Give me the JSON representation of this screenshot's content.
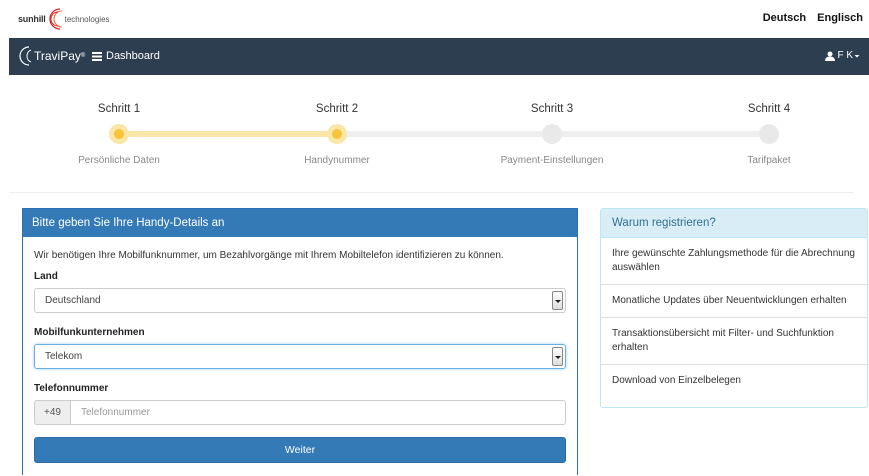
{
  "header": {
    "logo_left": "sunhill",
    "logo_right": "technologies",
    "languages": [
      "Deutsch",
      "Englisch"
    ]
  },
  "navbar": {
    "brand": "TraviPay",
    "brand_mark": "®",
    "dashboard": "Dashboard",
    "user": "F K"
  },
  "wizard": {
    "steps": [
      {
        "title": "Schritt 1",
        "subtitle": "Persönliche Daten",
        "status": "done"
      },
      {
        "title": "Schritt 2",
        "subtitle": "Handynummer",
        "status": "done"
      },
      {
        "title": "Schritt 3",
        "subtitle": "Payment-Einstellungen",
        "status": "todo"
      },
      {
        "title": "Schritt 4",
        "subtitle": "Tarifpaket",
        "status": "todo"
      }
    ],
    "active_color": "#f7c33a",
    "inactive_color": "#e9e9e9"
  },
  "form": {
    "heading": "Bitte geben Sie Ihre Handy-Details an",
    "intro": "Wir benötigen Ihre Mobilfunknummer, um Bezahlvorgänge mit Ihrem Mobiltelefon identifizieren zu können.",
    "country_label": "Land",
    "country_value": "Deutschland",
    "carrier_label": "Mobilfunkunternehmen",
    "carrier_value": "Telekom",
    "phone_label": "Telefonnummer",
    "phone_prefix": "+49",
    "phone_placeholder": "Telefonnummer",
    "submit": "Weiter"
  },
  "why": {
    "heading": "Warum registrieren?",
    "items": [
      "Ihre gewünschte Zahlungsmethode für die Abrechnung auswählen",
      "Monatliche Updates über Neuentwicklungen erhalten",
      "Transaktionsübersicht mit Filter- und Suchfunktion erhalten",
      "Download von Einzelbelegen"
    ]
  },
  "colors": {
    "navbar": "#2c3e50",
    "primary": "#337ab7",
    "info_bg": "#d9edf7",
    "info_text": "#31708f"
  }
}
